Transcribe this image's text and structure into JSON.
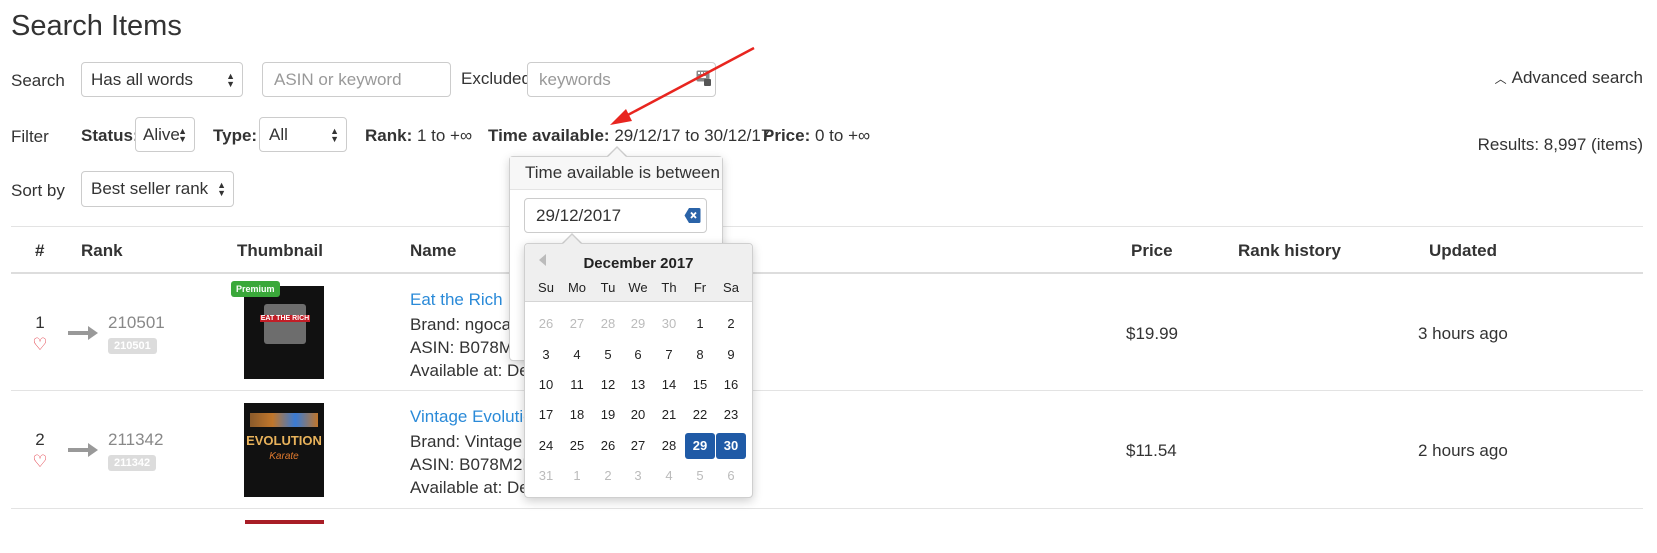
{
  "page_title": "Search Items",
  "search": {
    "label": "Search",
    "match_mode": "Has all words",
    "keyword_placeholder": "ASIN or keyword",
    "excluded_label": "Excluded:",
    "excluded_placeholder": "keywords",
    "advanced_link": "Advanced search"
  },
  "filter": {
    "label": "Filter",
    "status_label": "Status:",
    "status_value": "Alive",
    "type_label": "Type:",
    "type_value": "All",
    "rank_label": "Rank:",
    "rank_value": "1 to +∞",
    "time_label": "Time available:",
    "time_value": "29/12/17 to 30/12/17",
    "price_label": "Price:",
    "price_value": "0 to +∞",
    "results": "Results: 8,997 (items)"
  },
  "sort": {
    "label": "Sort by",
    "value": "Best seller rank"
  },
  "table": {
    "headers": {
      "num": "#",
      "rank": "Rank",
      "thumbnail": "Thumbnail",
      "name": "Name",
      "price": "Price",
      "rank_history": "Rank history",
      "updated": "Updated"
    },
    "rows": [
      {
        "num": "1",
        "rank": "210501",
        "rank_badge": "210501",
        "premium": "Premium",
        "thumb_text": "EAT THE RICH",
        "name": "Eat the Rich",
        "brand": "Brand: ngocao",
        "asin": "ASIN: B078M9",
        "available": "Available at: Dec",
        "price": "$19.99",
        "updated": "3 hours ago"
      },
      {
        "num": "2",
        "rank": "211342",
        "rank_badge": "211342",
        "premium": "",
        "thumb_text": "EVOLUTION",
        "thumb_sub": "Karate",
        "name": "Vintage Evolution",
        "brand": "Brand: Vintage S",
        "asin": "ASIN: B078M2BF",
        "available": "Available at: Dec",
        "price": "$11.54",
        "updated": "2 hours ago"
      }
    ]
  },
  "popover": {
    "title": "Time available is between",
    "date_value": "29/12/2017"
  },
  "calendar": {
    "month": "December 2017",
    "weekdays": [
      "Su",
      "Mo",
      "Tu",
      "We",
      "Th",
      "Fr",
      "Sa"
    ],
    "weeks": [
      [
        "26",
        "27",
        "28",
        "29",
        "30",
        "1",
        "2"
      ],
      [
        "3",
        "4",
        "5",
        "6",
        "7",
        "8",
        "9"
      ],
      [
        "10",
        "11",
        "12",
        "13",
        "14",
        "15",
        "16"
      ],
      [
        "17",
        "18",
        "19",
        "20",
        "21",
        "22",
        "23"
      ],
      [
        "24",
        "25",
        "26",
        "27",
        "28",
        "29",
        "30"
      ],
      [
        "31",
        "1",
        "2",
        "3",
        "4",
        "5",
        "6"
      ]
    ],
    "selected": [
      "29",
      "30"
    ]
  },
  "colors": {
    "link": "#2a8ad8",
    "heart": "#e0333f",
    "premium": "#3aa83a",
    "selected_day": "#1f5aa6",
    "annotation_arrow": "#e8251f"
  }
}
